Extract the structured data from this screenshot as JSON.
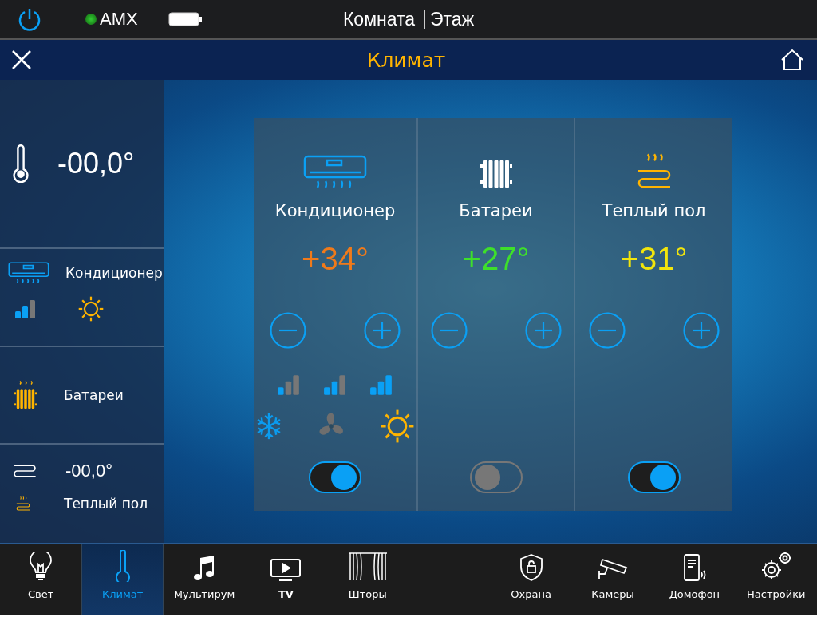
{
  "status_bar": {
    "device": "AMX",
    "connected": true,
    "room": "Комната",
    "floor": "Этаж"
  },
  "header": {
    "title": "Климат"
  },
  "sidebar": {
    "reading": "-00,0°",
    "items": [
      {
        "kind": "conditioner",
        "label": "Кондиционер"
      },
      {
        "kind": "radiator",
        "label": "Батареи"
      },
      {
        "kind": "floor",
        "label": "Теплый пол",
        "reading": "-00,0°"
      }
    ]
  },
  "zones": [
    {
      "kind": "conditioner",
      "name": "Кондиционер",
      "setpoint": "+34°",
      "color": "#f07a1a",
      "on": true,
      "speeds": [
        {
          "kind": "low"
        },
        {
          "kind": "medium"
        },
        {
          "kind": "high"
        }
      ],
      "modes": [
        {
          "kind": "cool",
          "color": "#0a9cf0"
        },
        {
          "kind": "fan",
          "color": "#6e6e6e"
        },
        {
          "kind": "heat",
          "color": "#ffb400"
        }
      ]
    },
    {
      "kind": "radiator",
      "name": "Батареи",
      "setpoint": "+27°",
      "color": "#3ee02a",
      "on": false
    },
    {
      "kind": "floor",
      "name": "Теплый пол",
      "setpoint": "+31°",
      "color": "#f2e50c",
      "on": true
    }
  ],
  "nav": {
    "left": [
      {
        "kind": "light",
        "label": "Свет",
        "selected": false
      },
      {
        "kind": "climate",
        "label": "Климат",
        "selected": true
      },
      {
        "kind": "music",
        "label": "Мультирум",
        "selected": false
      },
      {
        "kind": "tv",
        "label": "TV",
        "selected": false
      },
      {
        "kind": "curtains",
        "label": "Шторы",
        "selected": false
      }
    ],
    "right": [
      {
        "kind": "security",
        "label": "Охрана",
        "selected": false
      },
      {
        "kind": "camera",
        "label": "Камеры",
        "selected": false
      },
      {
        "kind": "intercom",
        "label": "Домофон",
        "selected": false
      },
      {
        "kind": "settings",
        "label": "Настройки",
        "selected": false
      }
    ]
  }
}
